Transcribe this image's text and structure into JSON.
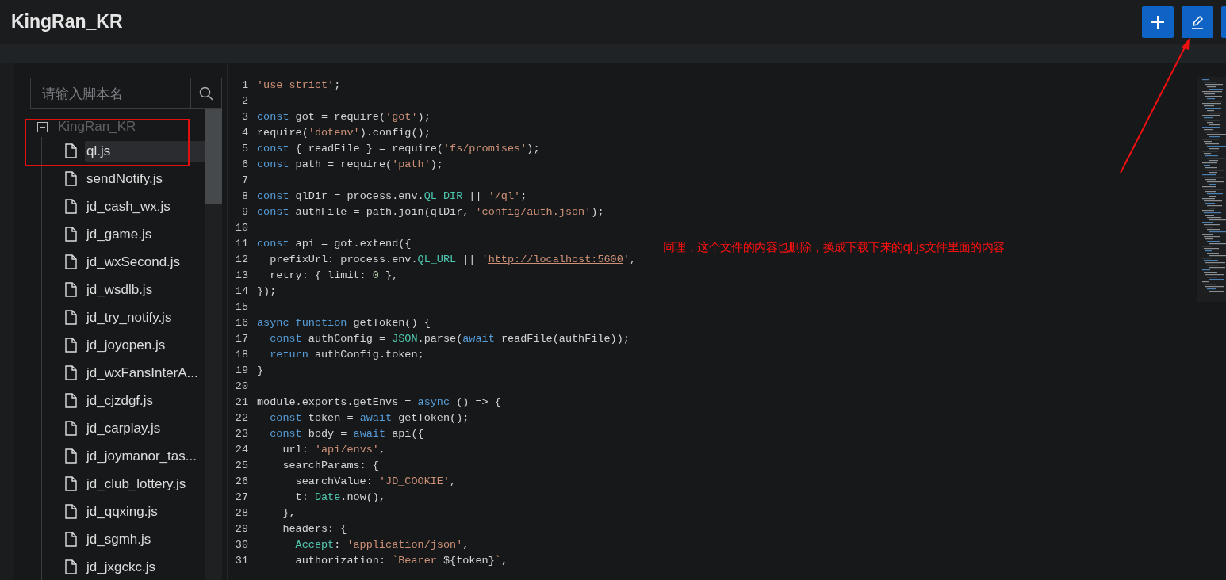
{
  "header": {
    "title": "KingRan_KR",
    "buttons": [
      {
        "kind": "add"
      },
      {
        "kind": "edit"
      },
      {
        "kind": "partial"
      }
    ]
  },
  "search": {
    "placeholder": "请输入脚本名"
  },
  "tree": {
    "label": "KingRan_KR",
    "expanded": true,
    "children": [
      {
        "label": "ql.js",
        "selected": true
      },
      {
        "label": "sendNotify.js",
        "selected": false
      },
      {
        "label": "jd_cash_wx.js",
        "selected": false
      },
      {
        "label": "jd_game.js",
        "selected": false
      },
      {
        "label": "jd_wxSecond.js",
        "selected": false
      },
      {
        "label": "jd_wsdlb.js",
        "selected": false
      },
      {
        "label": "jd_try_notify.js",
        "selected": false
      },
      {
        "label": "jd_joyopen.js",
        "selected": false
      },
      {
        "label": "jd_wxFansInterA...",
        "selected": false
      },
      {
        "label": "jd_cjzdgf.js",
        "selected": false
      },
      {
        "label": "jd_carplay.js",
        "selected": false
      },
      {
        "label": "jd_joymanor_tas...",
        "selected": false
      },
      {
        "label": "jd_club_lottery.js",
        "selected": false
      },
      {
        "label": "jd_qqxing.js",
        "selected": false
      },
      {
        "label": "jd_sgmh.js",
        "selected": false
      },
      {
        "label": "jd_jxgckc.js",
        "selected": false
      }
    ]
  },
  "editor": {
    "lines": [
      {
        "number": "1",
        "tokens": [
          {
            "text": "'use strict'",
            "kind": "string"
          },
          {
            "text": ";",
            "kind": "plain"
          }
        ]
      },
      {
        "number": "2"
      },
      {
        "number": "3",
        "tokens": [
          {
            "text": "const",
            "kind": "keyword"
          },
          {
            "text": " got = require(",
            "kind": "plain"
          },
          {
            "text": "'got'",
            "kind": "string"
          },
          {
            "text": ");",
            "kind": "plain"
          }
        ]
      },
      {
        "number": "4",
        "tokens": [
          {
            "text": "require(",
            "kind": "plain"
          },
          {
            "text": "'dotenv'",
            "kind": "string"
          },
          {
            "text": ").config();",
            "kind": "plain"
          }
        ]
      },
      {
        "number": "5",
        "tokens": [
          {
            "text": "const",
            "kind": "keyword"
          },
          {
            "text": " { readFile } = require(",
            "kind": "plain"
          },
          {
            "text": "'fs/promises'",
            "kind": "string"
          },
          {
            "text": ");",
            "kind": "plain"
          }
        ]
      },
      {
        "number": "6",
        "tokens": [
          {
            "text": "const",
            "kind": "keyword"
          },
          {
            "text": " path = require(",
            "kind": "plain"
          },
          {
            "text": "'path'",
            "kind": "string"
          },
          {
            "text": ");",
            "kind": "plain"
          }
        ]
      },
      {
        "number": "7"
      },
      {
        "number": "8",
        "tokens": [
          {
            "text": "const",
            "kind": "keyword"
          },
          {
            "text": " qlDir = process.env.",
            "kind": "plain"
          },
          {
            "text": "QL_DIR",
            "kind": "type"
          },
          {
            "text": " || ",
            "kind": "plain"
          },
          {
            "text": "'/ql'",
            "kind": "string"
          },
          {
            "text": ";",
            "kind": "plain"
          }
        ]
      },
      {
        "number": "9",
        "tokens": [
          {
            "text": "const",
            "kind": "keyword"
          },
          {
            "text": " authFile = path.join(qlDir, ",
            "kind": "plain"
          },
          {
            "text": "'config/auth.json'",
            "kind": "string"
          },
          {
            "text": ");",
            "kind": "plain"
          }
        ]
      },
      {
        "number": "10"
      },
      {
        "number": "11",
        "tokens": [
          {
            "text": "const",
            "kind": "keyword"
          },
          {
            "text": " api = got.extend({",
            "kind": "plain"
          }
        ]
      },
      {
        "number": "12",
        "tokens": [
          {
            "text": "  prefixUrl: process.env.",
            "kind": "plain"
          },
          {
            "text": "QL_URL",
            "kind": "type"
          },
          {
            "text": " || ",
            "kind": "plain"
          },
          {
            "text": "'",
            "kind": "string"
          },
          {
            "text": "http://localhost:5600",
            "kind": "link"
          },
          {
            "text": "'",
            "kind": "string"
          },
          {
            "text": ",",
            "kind": "plain"
          }
        ]
      },
      {
        "number": "13",
        "tokens": [
          {
            "text": "  retry: { limit: ",
            "kind": "plain"
          },
          {
            "text": "0",
            "kind": "number"
          },
          {
            "text": " },",
            "kind": "plain"
          }
        ]
      },
      {
        "number": "14",
        "tokens": [
          {
            "text": "});",
            "kind": "plain"
          }
        ]
      },
      {
        "number": "15"
      },
      {
        "number": "16",
        "tokens": [
          {
            "text": "async function",
            "kind": "keyword"
          },
          {
            "text": " getToken() {",
            "kind": "plain"
          }
        ]
      },
      {
        "number": "17",
        "tokens": [
          {
            "text": "  const",
            "kind": "keyword"
          },
          {
            "text": " authConfig = ",
            "kind": "plain"
          },
          {
            "text": "JSON",
            "kind": "type"
          },
          {
            "text": ".parse(",
            "kind": "plain"
          },
          {
            "text": "await",
            "kind": "keyword"
          },
          {
            "text": " readFile(authFile));",
            "kind": "plain"
          }
        ]
      },
      {
        "number": "18",
        "tokens": [
          {
            "text": "  return",
            "kind": "keyword"
          },
          {
            "text": " authConfig.token;",
            "kind": "plain"
          }
        ]
      },
      {
        "number": "19",
        "tokens": [
          {
            "text": "}",
            "kind": "plain"
          }
        ]
      },
      {
        "number": "20"
      },
      {
        "number": "21",
        "tokens": [
          {
            "text": "module.exports.getEnvs = ",
            "kind": "plain"
          },
          {
            "text": "async",
            "kind": "keyword"
          },
          {
            "text": " () => {",
            "kind": "plain"
          }
        ]
      },
      {
        "number": "22",
        "tokens": [
          {
            "text": "  const",
            "kind": "keyword"
          },
          {
            "text": " token = ",
            "kind": "plain"
          },
          {
            "text": "await",
            "kind": "keyword"
          },
          {
            "text": " getToken();",
            "kind": "plain"
          }
        ]
      },
      {
        "number": "23",
        "tokens": [
          {
            "text": "  const",
            "kind": "keyword"
          },
          {
            "text": " body = ",
            "kind": "plain"
          },
          {
            "text": "await",
            "kind": "keyword"
          },
          {
            "text": " api({",
            "kind": "plain"
          }
        ]
      },
      {
        "number": "24",
        "tokens": [
          {
            "text": "    url: ",
            "kind": "plain"
          },
          {
            "text": "'api/envs'",
            "kind": "string"
          },
          {
            "text": ",",
            "kind": "plain"
          }
        ]
      },
      {
        "number": "25",
        "tokens": [
          {
            "text": "    searchParams: {",
            "kind": "plain"
          }
        ]
      },
      {
        "number": "26",
        "tokens": [
          {
            "text": "      searchValue: ",
            "kind": "plain"
          },
          {
            "text": "'JD_COOKIE'",
            "kind": "string"
          },
          {
            "text": ",",
            "kind": "plain"
          }
        ]
      },
      {
        "number": "27",
        "tokens": [
          {
            "text": "      t: ",
            "kind": "plain"
          },
          {
            "text": "Date",
            "kind": "type"
          },
          {
            "text": ".now(),",
            "kind": "plain"
          }
        ]
      },
      {
        "number": "28",
        "tokens": [
          {
            "text": "    },",
            "kind": "plain"
          }
        ]
      },
      {
        "number": "29",
        "tokens": [
          {
            "text": "    headers: {",
            "kind": "plain"
          }
        ]
      },
      {
        "number": "30",
        "tokens": [
          {
            "text": "      Accept",
            "kind": "type"
          },
          {
            "text": ": ",
            "kind": "plain"
          },
          {
            "text": "'application/json'",
            "kind": "string"
          },
          {
            "text": ",",
            "kind": "plain"
          }
        ]
      },
      {
        "number": "31",
        "tokens": [
          {
            "text": "      authorization: ",
            "kind": "plain"
          },
          {
            "text": "`Bearer ",
            "kind": "string"
          },
          {
            "text": "${token}",
            "kind": "plain"
          },
          {
            "text": "`",
            "kind": "string"
          },
          {
            "text": ",",
            "kind": "plain"
          }
        ]
      }
    ]
  },
  "annotation": {
    "note": "同理，这个文件的内容也删除，换成下载下来的ql.js文件里面的内容"
  }
}
